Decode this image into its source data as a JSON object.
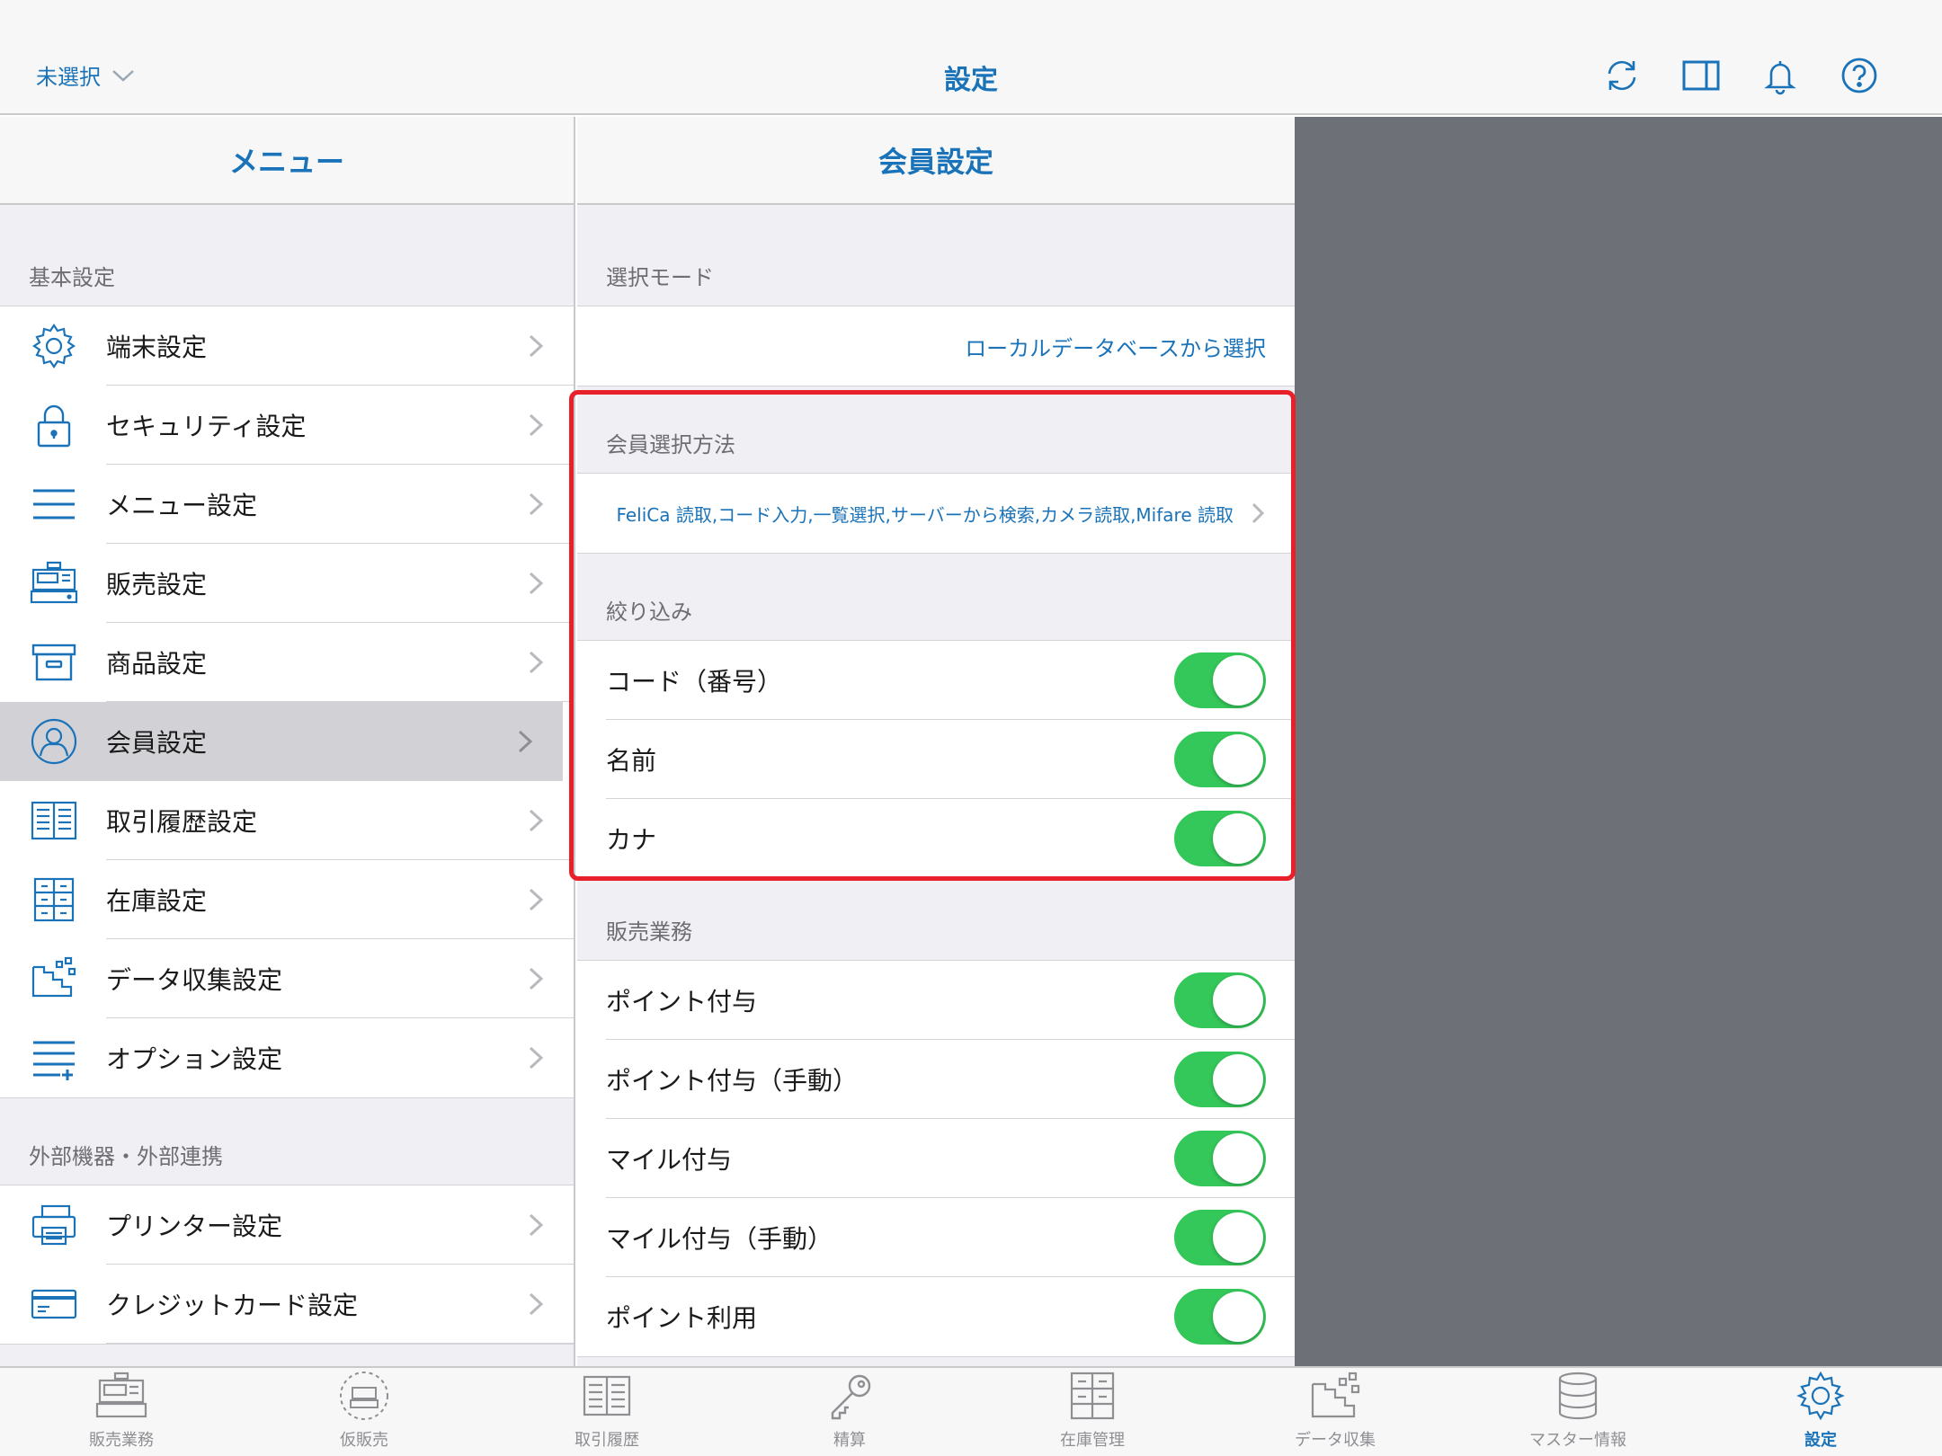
{
  "topbar": {
    "store_select": "未選択",
    "title": "設定",
    "icons": [
      "sync-icon",
      "split-view-icon",
      "bell-icon",
      "help-icon"
    ]
  },
  "menu": {
    "header": "メニュー",
    "sections": [
      {
        "label": "基本設定",
        "items": [
          {
            "label": "端末設定",
            "icon": "gear-icon"
          },
          {
            "label": "セキュリティ設定",
            "icon": "lock-icon"
          },
          {
            "label": "メニュー設定",
            "icon": "list-icon"
          },
          {
            "label": "販売設定",
            "icon": "register-icon"
          },
          {
            "label": "商品設定",
            "icon": "box-icon"
          },
          {
            "label": "会員設定",
            "icon": "user-icon",
            "selected": true
          },
          {
            "label": "取引履歴設定",
            "icon": "book-icon"
          },
          {
            "label": "在庫設定",
            "icon": "cabinet-icon"
          },
          {
            "label": "データ収集設定",
            "icon": "data-collect-icon"
          },
          {
            "label": "オプション設定",
            "icon": "list-plus-icon"
          }
        ]
      },
      {
        "label": "外部機器・外部連携",
        "items": [
          {
            "label": "プリンター設定",
            "icon": "printer-icon"
          },
          {
            "label": "クレジットカード設定",
            "icon": "credit-card-icon"
          }
        ]
      }
    ]
  },
  "detail": {
    "header": "会員設定",
    "select_mode": {
      "label": "選択モード",
      "value": "ローカルデータベースから選択"
    },
    "select_method": {
      "label": "会員選択方法",
      "value": "FeliCa 読取,コード入力,一覧選択,サーバーから検索,カメラ読取,Mifare 読取"
    },
    "filter": {
      "label": "絞り込み",
      "items": [
        {
          "label": "コード（番号）",
          "on": true
        },
        {
          "label": "名前",
          "on": true
        },
        {
          "label": "カナ",
          "on": true
        }
      ]
    },
    "sales": {
      "label": "販売業務",
      "items": [
        {
          "label": "ポイント付与",
          "on": true
        },
        {
          "label": "ポイント付与（手動）",
          "on": true
        },
        {
          "label": "マイル付与",
          "on": true
        },
        {
          "label": "マイル付与（手動）",
          "on": true
        },
        {
          "label": "ポイント利用",
          "on": true
        }
      ]
    }
  },
  "tabs": [
    {
      "label": "販売業務",
      "icon": "register-icon"
    },
    {
      "label": "仮販売",
      "icon": "temp-sale-icon"
    },
    {
      "label": "取引履歴",
      "icon": "book-icon"
    },
    {
      "label": "精算",
      "icon": "key-icon"
    },
    {
      "label": "在庫管理",
      "icon": "cabinet-icon"
    },
    {
      "label": "データ収集",
      "icon": "data-collect-icon"
    },
    {
      "label": "マスター情報",
      "icon": "database-icon"
    },
    {
      "label": "設定",
      "icon": "gear-icon",
      "active": true
    }
  ],
  "colors": {
    "accent": "#1a73b8",
    "toggle_on": "#34c759",
    "highlight": "#e8202a",
    "dim_overlay": "#6d7077"
  }
}
